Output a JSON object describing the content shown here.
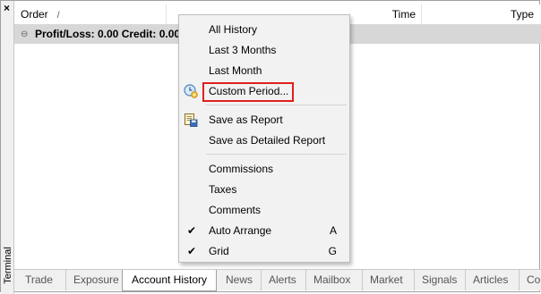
{
  "window": {
    "side_label": "Terminal",
    "close_glyph": "×"
  },
  "table": {
    "columns": {
      "order": "Order",
      "order_sort": "/",
      "time": "Time",
      "type": "Type"
    },
    "summary": {
      "text": "Profit/Loss: 0.00  Credit: 0.00",
      "icon": "collapse-icon"
    }
  },
  "menu": {
    "items": [
      {
        "label": "All History"
      },
      {
        "label": "Last 3 Months"
      },
      {
        "label": "Last Month"
      },
      {
        "label": "Custom Period...",
        "icon": "calendar-clock-icon",
        "highlighted": true
      },
      {
        "label": "Save as Report",
        "icon": "save-report-icon"
      },
      {
        "label": "Save as Detailed Report"
      },
      {
        "label": "Commissions"
      },
      {
        "label": "Taxes"
      },
      {
        "label": "Comments"
      },
      {
        "label": "Auto Arrange",
        "checked": true,
        "accelerator": "A"
      },
      {
        "label": "Grid",
        "checked": true,
        "accelerator": "G"
      }
    ],
    "check_glyph": "✔",
    "highlight_color": "#e01f1f"
  },
  "tabs": [
    {
      "label": "Trade"
    },
    {
      "label": "Exposure"
    },
    {
      "label": "Account History",
      "active": true
    },
    {
      "label": "News"
    },
    {
      "label": "Alerts"
    },
    {
      "label": "Mailbox"
    },
    {
      "label": "Market"
    },
    {
      "label": "Signals"
    },
    {
      "label": "Articles"
    },
    {
      "label": "Coc"
    }
  ]
}
